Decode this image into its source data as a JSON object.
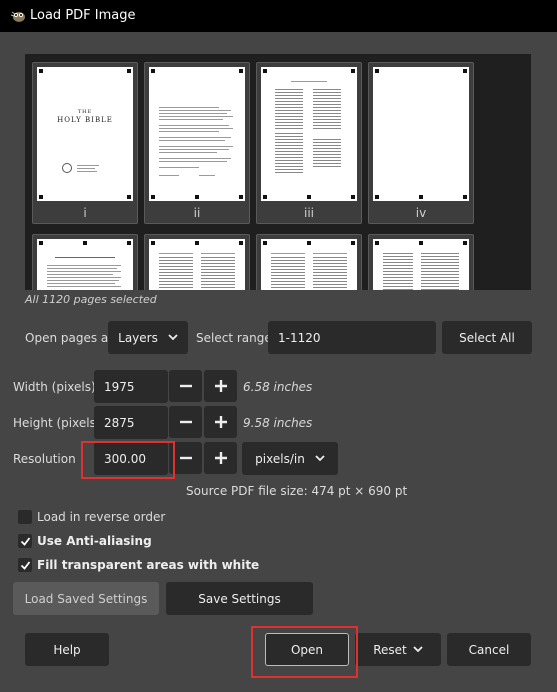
{
  "window": {
    "title": "Load PDF Image",
    "app_icon": "gimp-icon"
  },
  "thumbnails": [
    {
      "label": "i",
      "page_title": "THE\nHOLY BIBLE"
    },
    {
      "label": "ii"
    },
    {
      "label": "iii"
    },
    {
      "label": "iv"
    }
  ],
  "selected_text": "All 1120 pages selected",
  "open_pages": {
    "label": "Open pages as",
    "value": "Layers"
  },
  "select_range": {
    "label": "Select range:",
    "value": "1-1120"
  },
  "select_all_label": "Select All",
  "width": {
    "label": "Width (pixels)",
    "value": "1975",
    "hint": "6.58 inches"
  },
  "height": {
    "label": "Height (pixels)",
    "value": "2875",
    "hint": "9.58 inches"
  },
  "resolution": {
    "label": "Resolution",
    "value": "300.00",
    "unit": "pixels/in"
  },
  "source_size": "Source PDF file size: 474 pt × 690 pt",
  "options": [
    {
      "label": "Load in reverse order",
      "checked": false
    },
    {
      "label": "Use Anti-aliasing",
      "checked": true
    },
    {
      "label": "Fill transparent areas with white",
      "checked": true
    }
  ],
  "load_saved_label": "Load Saved Settings",
  "save_settings_label": "Save Settings",
  "footer": {
    "help": "Help",
    "open": "Open",
    "reset": "Reset",
    "cancel": "Cancel"
  },
  "colors": {
    "dialog_bg": "#454545",
    "widget_bg": "#2a2a2a",
    "highlight": "#e03030"
  }
}
